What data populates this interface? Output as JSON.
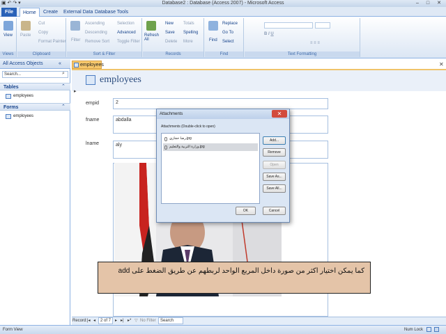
{
  "window": {
    "title": "Database2 : Database (Access 2007) - Microsoft Access",
    "controls": [
      "–",
      "□",
      "✕"
    ]
  },
  "ribbon": {
    "tabs": [
      "File",
      "Home",
      "Create",
      "External Data",
      "Database Tools"
    ],
    "active_tab": "Home",
    "groups": {
      "views": {
        "label": "Views",
        "view": "View"
      },
      "clipboard": {
        "label": "Clipboard",
        "paste": "Paste",
        "cut": "Cut",
        "copy": "Copy",
        "format_painter": "Format Painter"
      },
      "sort_filter": {
        "label": "Sort & Filter",
        "filter": "Filter",
        "ascending": "Ascending",
        "descending": "Descending",
        "remove_sort": "Remove Sort",
        "selection": "Selection",
        "advanced": "Advanced",
        "toggle_filter": "Toggle Filter"
      },
      "records": {
        "label": "Records",
        "refresh": "Refresh All",
        "new": "New",
        "save": "Save",
        "delete": "Delete",
        "totals": "Totals",
        "spelling": "Spelling",
        "more": "More"
      },
      "find": {
        "label": "Find",
        "find": "Find",
        "replace": "Replace",
        "goto": "Go To",
        "select": "Select"
      },
      "text_formatting": {
        "label": "Text Formatting"
      }
    }
  },
  "nav_pane": {
    "header": "All Access Objects",
    "search_placeholder": "Search...",
    "sections": [
      {
        "label": "Tables",
        "items": [
          "employees"
        ]
      },
      {
        "label": "Forms",
        "items": [
          "employees"
        ]
      }
    ]
  },
  "document": {
    "tab_label": "employees",
    "form_title": "employees",
    "fields": [
      {
        "label": "empid",
        "value": "2"
      },
      {
        "label": "fname",
        "value": "abdalla"
      },
      {
        "label": "lname",
        "value": "aly"
      }
    ]
  },
  "record_nav": {
    "label": "Record:",
    "position": "2 of 7",
    "filter": "No Filter",
    "search": "Search"
  },
  "status_bar": {
    "left": "Form View",
    "right": "Num Lock"
  },
  "dialog": {
    "title": "Attachments",
    "subtitle": "Attachments (Double-click to open)",
    "files": [
      "رضا حجازي.jpg",
      "وزارة التربية والتعليم.jpg"
    ],
    "selected_index": 1,
    "buttons": {
      "add": "Add...",
      "remove": "Remove",
      "open": "Open",
      "save_as": "Save As...",
      "save_all": "Save All...",
      "ok": "OK",
      "cancel": "Cancel"
    }
  },
  "callout": {
    "text": "كما يمكن اختيار اكثر من صورة داخل المربع الواحد لربطهم عن طريق الضغط على add"
  }
}
